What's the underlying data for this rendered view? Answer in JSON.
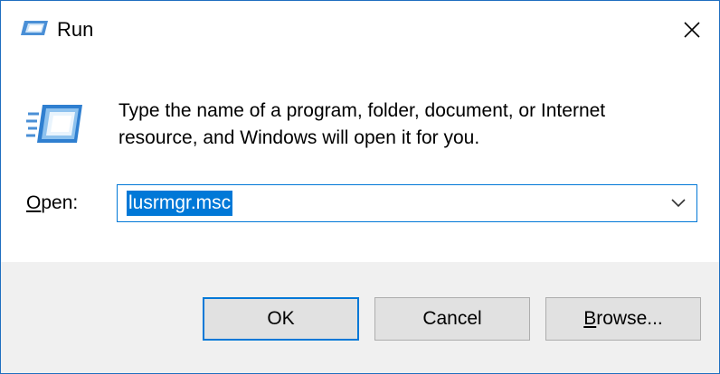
{
  "window": {
    "title": "Run",
    "title_icon": "run-icon",
    "close_icon": "close-icon"
  },
  "content": {
    "icon": "run-icon",
    "prompt_line1": "Type the name of a program, folder, document, or Internet",
    "prompt_line2": "resource, and Windows will open it for you."
  },
  "open_field": {
    "label_mnemonic": "O",
    "label_rest": "pen:",
    "value": "lusrmgr.msc",
    "dropdown_icon": "chevron-down-icon"
  },
  "buttons": {
    "ok_label": "OK",
    "cancel_label": "Cancel",
    "browse_mnemonic": "B",
    "browse_rest": "rowse..."
  },
  "colors": {
    "accent": "#0078d7",
    "footer_bg": "#f0f0f0",
    "button_bg": "#e1e1e1",
    "window_border": "#1f6fc0"
  }
}
